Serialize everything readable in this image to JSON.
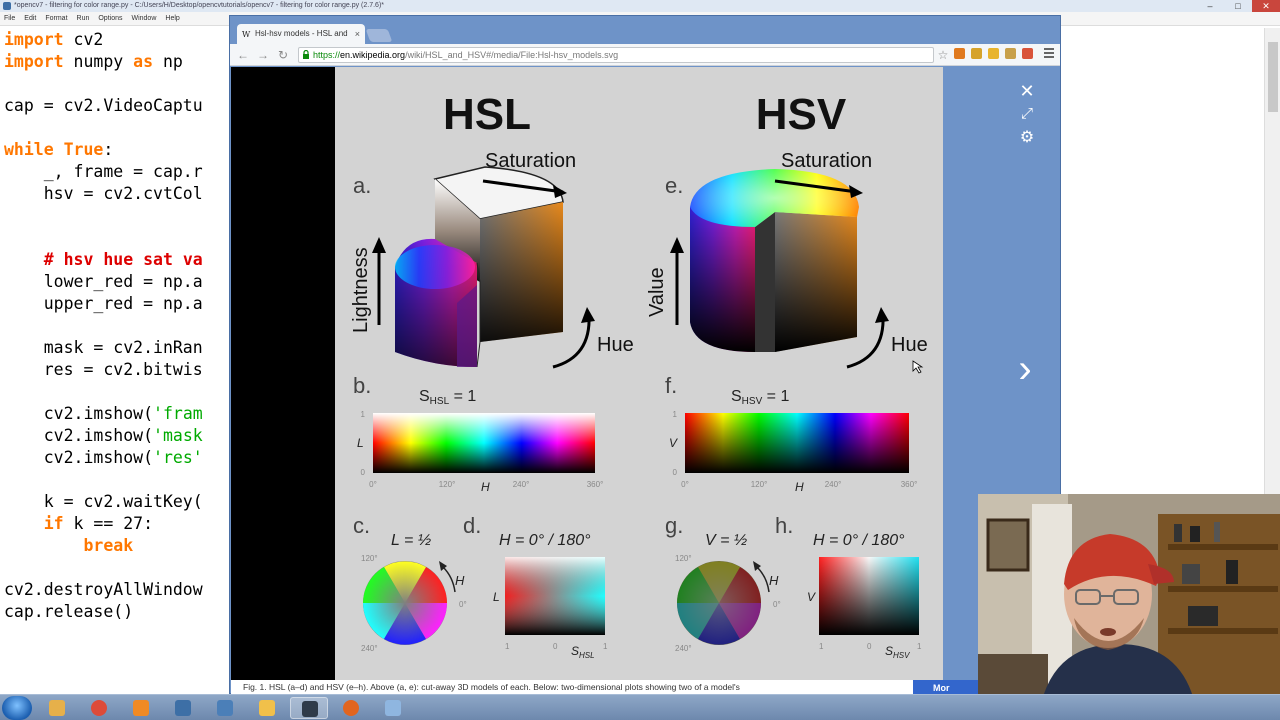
{
  "idle": {
    "title": "*opencv7 - filtering for color range.py - C:/Users/H/Desktop/opencvtutorials/opencv7 - filtering for color range.py (2.7.6)*",
    "window_buttons": [
      "–",
      "□",
      "✕"
    ],
    "menu": [
      "File",
      "Edit",
      "Format",
      "Run",
      "Options",
      "Window",
      "Help"
    ],
    "code": [
      [
        {
          "t": "import",
          "c": "kw"
        },
        {
          "t": " cv2",
          "c": ""
        }
      ],
      [
        {
          "t": "import",
          "c": "kw"
        },
        {
          "t": " numpy ",
          "c": ""
        },
        {
          "t": "as",
          "c": "kw"
        },
        {
          "t": " np",
          "c": ""
        }
      ],
      [],
      [
        {
          "t": "cap = cv2.VideoCaptu",
          "c": ""
        }
      ],
      [],
      [
        {
          "t": "while",
          "c": "kw"
        },
        {
          "t": " ",
          "c": ""
        },
        {
          "t": "True",
          "c": "kw"
        },
        {
          "t": ":",
          "c": ""
        }
      ],
      [
        {
          "t": "    _, frame = cap.r",
          "c": ""
        }
      ],
      [
        {
          "t": "    hsv = cv2.cvtCol",
          "c": ""
        }
      ],
      [],
      [],
      [
        {
          "t": "    ",
          "c": ""
        },
        {
          "t": "# hsv hue sat va",
          "c": "cm"
        }
      ],
      [
        {
          "t": "    lower_red = np.a",
          "c": ""
        }
      ],
      [
        {
          "t": "    upper_red = np.a",
          "c": ""
        }
      ],
      [],
      [
        {
          "t": "    mask = cv2.inRan",
          "c": ""
        }
      ],
      [
        {
          "t": "    res = cv2.bitwis",
          "c": ""
        }
      ],
      [],
      [
        {
          "t": "    cv2.imshow(",
          "c": ""
        },
        {
          "t": "'fram",
          "c": "st"
        }
      ],
      [
        {
          "t": "    cv2.imshow(",
          "c": ""
        },
        {
          "t": "'mask",
          "c": "st"
        }
      ],
      [
        {
          "t": "    cv2.imshow(",
          "c": ""
        },
        {
          "t": "'res'",
          "c": "st"
        }
      ],
      [],
      [
        {
          "t": "    k = cv2.waitKey(",
          "c": ""
        }
      ],
      [
        {
          "t": "    ",
          "c": ""
        },
        {
          "t": "if",
          "c": "kw"
        },
        {
          "t": " k == 27:",
          "c": ""
        }
      ],
      [
        {
          "t": "        ",
          "c": ""
        },
        {
          "t": "break",
          "c": "kw"
        }
      ],
      [],
      [
        {
          "t": "cv2.destroyAllWindow",
          "c": ""
        }
      ],
      [
        {
          "t": "cap.release()",
          "c": ""
        }
      ]
    ]
  },
  "browser": {
    "tab_title": "Hsl-hsv models - HSL and",
    "tab_favicon": "W",
    "tab_close": "×",
    "url_scheme": "https://",
    "url_host": "en.wikipedia.org",
    "url_path": "/wiki/HSL_and_HSV#/media/File:Hsl-hsv_models.svg",
    "nav": {
      "back": "←",
      "forward": "→",
      "reload": "↻"
    },
    "star": "☆",
    "extension_colors": [
      "#e07a1f",
      "#d6a32a",
      "#e8b42d",
      "#c8a04a",
      "#d9533a"
    ],
    "caption": "Fig. 1. HSL (a–d) and HSV (e–h). Above (a, e): cut-away 3D models of each. Below: two-dimensional plots showing two of a model's",
    "more_label": "Mor",
    "lightbox": {
      "close": "✕",
      "expand": "⤢",
      "settings": "⚙",
      "next": "›"
    }
  },
  "figure": {
    "hsl_title": "HSL",
    "hsv_title": "HSV",
    "label_a": "a.",
    "label_b": "b.",
    "label_c": "c.",
    "label_d": "d.",
    "label_e": "e.",
    "label_f": "f.",
    "label_g": "g.",
    "label_h": "h.",
    "saturation": "Saturation",
    "lightness": "Lightness",
    "value": "Value",
    "hue": "Hue",
    "s_hsl_eq": "S",
    "s_hsl_sub": "HSL",
    "s_hsv_sub": "HSV",
    "eq_one": " = 1",
    "axis_l": "L",
    "axis_v": "V",
    "axis_h": "H",
    "tick_0deg": "0°",
    "tick_120": "120°",
    "tick_240": "240°",
    "tick_360": "360°",
    "tick_1": "1",
    "tick_0": "0",
    "l_half": "L = ½",
    "v_half": "V = ½",
    "h_0_180": "H = 0° / 180°",
    "small_h": "H",
    "axis_s": "S"
  },
  "taskbar": {
    "items": [
      {
        "name": "explorer",
        "color": "#e6b04a"
      },
      {
        "name": "chrome",
        "color": "#dd4b39"
      },
      {
        "name": "media-player",
        "color": "#f08a24"
      },
      {
        "name": "python-idle-1",
        "color": "#3d6fa6"
      },
      {
        "name": "python-idle-2",
        "color": "#4b7fb8"
      },
      {
        "name": "python-idle-3",
        "color": "#f1c04a"
      },
      {
        "name": "screen-recorder",
        "color": "#2f3b4a"
      },
      {
        "name": "firefox",
        "color": "#e1651f"
      },
      {
        "name": "network-drive",
        "color": "#8fb6e0"
      }
    ]
  }
}
